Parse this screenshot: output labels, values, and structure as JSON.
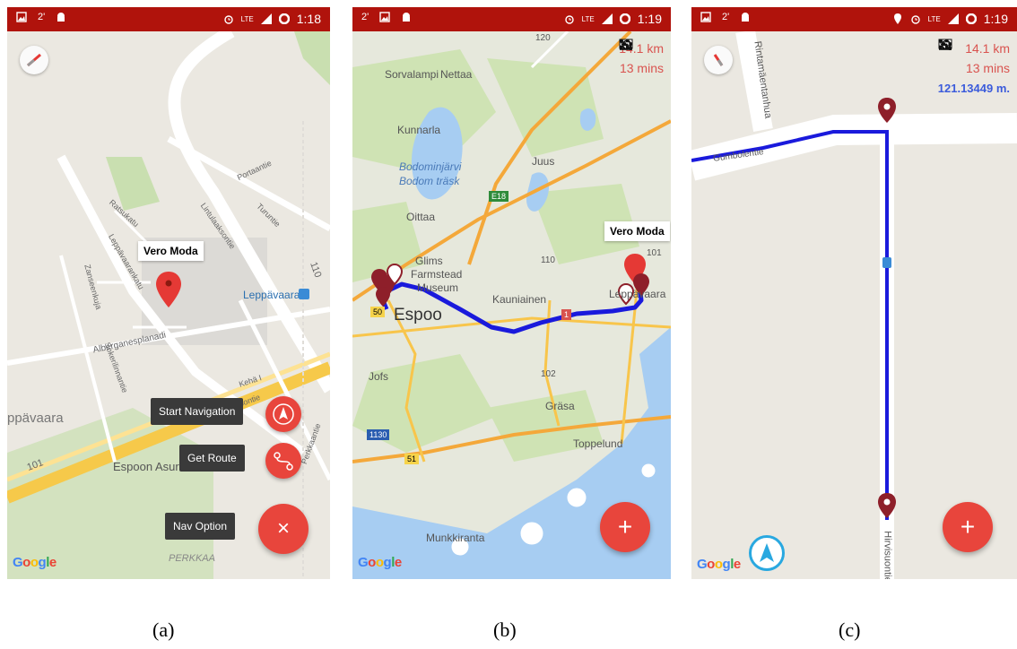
{
  "screens": {
    "a": {
      "status_time": "1:18",
      "status_network": "LTE",
      "info_window": "Vero Moda",
      "place_label": "Leppävaara",
      "place_label_left": "ppävaara",
      "roads": {
        "r1": "Ratsukatu",
        "r2": "Leppävaarankatu",
        "r3": "Zanseenkuja",
        "r4": "Alberganesplanadi",
        "r5": "Sokerilinnantie",
        "r6": "Kehä I",
        "r7": "Perkkaantie",
        "r8": "Portaantie",
        "r9": "Turuntie",
        "r10": "Lintulaaksontie",
        "r11": "Porvoontie",
        "r12": "101",
        "r13": "110",
        "r14": "PERKKAA"
      },
      "place_bottom": "Espoon Asur",
      "menu": {
        "start_navigation": "Start Navigation",
        "get_route": "Get Route",
        "nav_option": "Nav Option"
      },
      "fab_label": "×",
      "google": [
        "G",
        "o",
        "o",
        "g",
        "l",
        "e"
      ]
    },
    "b": {
      "status_time": "1:19",
      "status_network": "LTE",
      "distance": "14.1 km",
      "duration": "13 mins",
      "info_window": "Vero Moda",
      "labels": {
        "l120": "120",
        "sorvalampi": "Sorvalampi",
        "nettaa": "Nettaa",
        "kunnarla": "Kunnarla",
        "bodom1": "Bodominjärvi",
        "bodom2": "Bodom träsk",
        "juus": "Juus",
        "e18": "E18",
        "oittaa": "Oittaa",
        "glims1": "Glims",
        "glims2": "Farmstead",
        "glims3": "Museum",
        "l110": "110",
        "kauniainen": "Kauniainen",
        "l101": "101",
        "leppavaara": "Leppävaara",
        "l50": "50",
        "espoo": "Espoo",
        "jofs": "Jofs",
        "l102": "102",
        "grasa": "Gräsa",
        "l1130": "1130",
        "toppelund": "Toppelund",
        "l51": "51",
        "munkkiranta": "Munkkiranta",
        "l1": "1"
      },
      "fab_label": "+",
      "google": [
        "G",
        "o",
        "o",
        "g",
        "l",
        "e"
      ]
    },
    "c": {
      "status_time": "1:19",
      "status_network": "LTE",
      "distance": "14.1 km",
      "duration": "13 mins",
      "meters": "121.13449 m.",
      "roads": {
        "rintamaentanhua": "Rintamäentanhua",
        "gumbolentie": "Gumbolentie",
        "hirvisuontie": "Hirvisuontie"
      },
      "fab_label": "+",
      "google": [
        "G",
        "o",
        "o",
        "g",
        "l",
        "e"
      ]
    }
  },
  "captions": {
    "a": "(a)",
    "b": "(b)",
    "c": "(c)"
  },
  "colors": {
    "statusbar": "#b0130c",
    "fab": "#e8453c",
    "route": "#1a1adc",
    "accent_text": "#d9534f"
  },
  "icons": [
    "image-icon",
    "alarm-icon",
    "signal-icon",
    "battery-icon",
    "checkered-flag-icon",
    "snail-icon",
    "route-icon",
    "compass-icon",
    "navigation-arrow-icon",
    "location-pin-icon"
  ]
}
